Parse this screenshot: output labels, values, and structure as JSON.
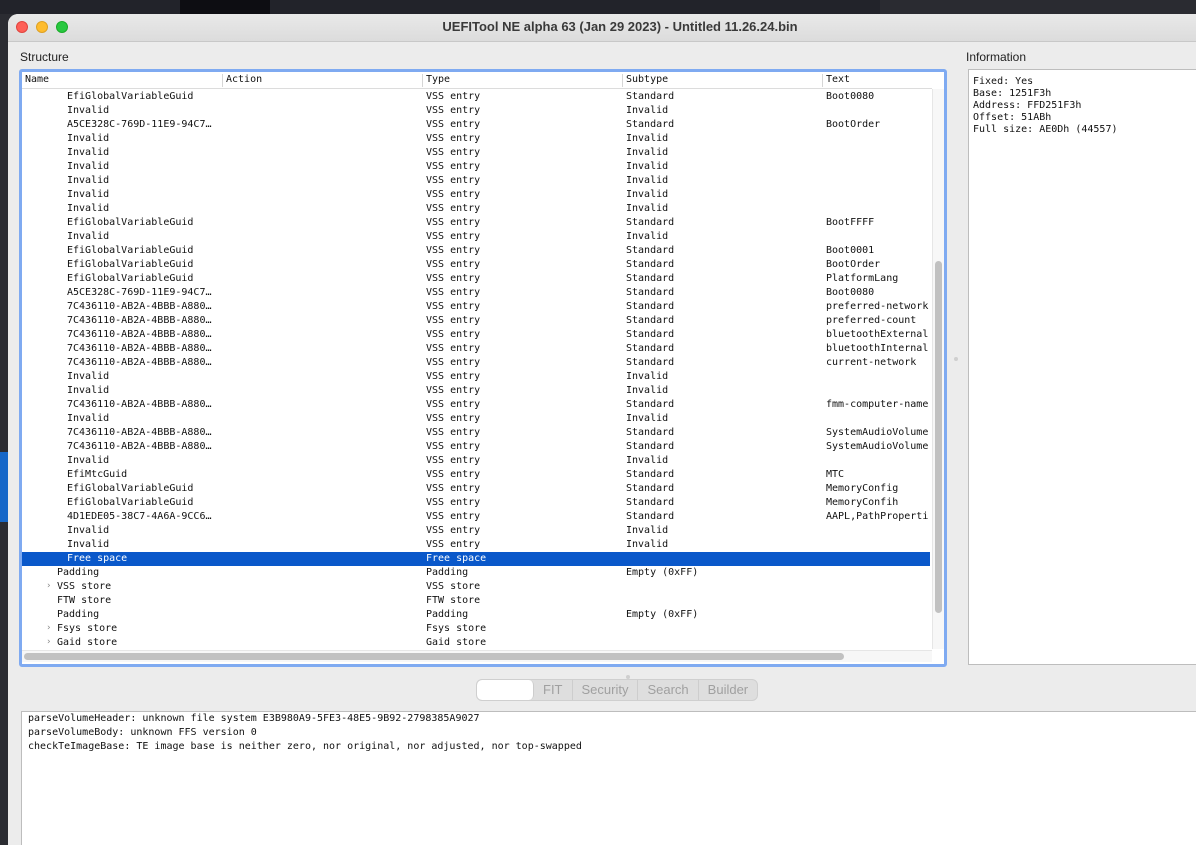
{
  "window": {
    "title": "UEFITool NE alpha 63 (Jan 29 2023) - Untitled 11.26.24.bin"
  },
  "structure": {
    "label": "Structure",
    "columns": [
      "Name",
      "Action",
      "Type",
      "Subtype",
      "Text"
    ],
    "rows": [
      {
        "name": "EfiGlobalVariableGuid",
        "type": "VSS entry",
        "subtype": "Standard",
        "text": "Boot0080",
        "indent": 3
      },
      {
        "name": "Invalid",
        "type": "VSS entry",
        "subtype": "Invalid",
        "text": "",
        "indent": 3
      },
      {
        "name": "A5CE328C-769D-11E9-94C7…",
        "type": "VSS entry",
        "subtype": "Standard",
        "text": "BootOrder",
        "indent": 3
      },
      {
        "name": "Invalid",
        "type": "VSS entry",
        "subtype": "Invalid",
        "text": "",
        "indent": 3
      },
      {
        "name": "Invalid",
        "type": "VSS entry",
        "subtype": "Invalid",
        "text": "",
        "indent": 3
      },
      {
        "name": "Invalid",
        "type": "VSS entry",
        "subtype": "Invalid",
        "text": "",
        "indent": 3
      },
      {
        "name": "Invalid",
        "type": "VSS entry",
        "subtype": "Invalid",
        "text": "",
        "indent": 3
      },
      {
        "name": "Invalid",
        "type": "VSS entry",
        "subtype": "Invalid",
        "text": "",
        "indent": 3
      },
      {
        "name": "Invalid",
        "type": "VSS entry",
        "subtype": "Invalid",
        "text": "",
        "indent": 3
      },
      {
        "name": "EfiGlobalVariableGuid",
        "type": "VSS entry",
        "subtype": "Standard",
        "text": "BootFFFF",
        "indent": 3
      },
      {
        "name": "Invalid",
        "type": "VSS entry",
        "subtype": "Invalid",
        "text": "",
        "indent": 3
      },
      {
        "name": "EfiGlobalVariableGuid",
        "type": "VSS entry",
        "subtype": "Standard",
        "text": "Boot0001",
        "indent": 3
      },
      {
        "name": "EfiGlobalVariableGuid",
        "type": "VSS entry",
        "subtype": "Standard",
        "text": "BootOrder",
        "indent": 3
      },
      {
        "name": "EfiGlobalVariableGuid",
        "type": "VSS entry",
        "subtype": "Standard",
        "text": "PlatformLang",
        "indent": 3
      },
      {
        "name": "A5CE328C-769D-11E9-94C7…",
        "type": "VSS entry",
        "subtype": "Standard",
        "text": "Boot0080",
        "indent": 3
      },
      {
        "name": "7C436110-AB2A-4BBB-A880…",
        "type": "VSS entry",
        "subtype": "Standard",
        "text": "preferred-network",
        "indent": 3
      },
      {
        "name": "7C436110-AB2A-4BBB-A880…",
        "type": "VSS entry",
        "subtype": "Standard",
        "text": "preferred-count",
        "indent": 3
      },
      {
        "name": "7C436110-AB2A-4BBB-A880…",
        "type": "VSS entry",
        "subtype": "Standard",
        "text": "bluetoothExternal",
        "indent": 3
      },
      {
        "name": "7C436110-AB2A-4BBB-A880…",
        "type": "VSS entry",
        "subtype": "Standard",
        "text": "bluetoothInternal",
        "indent": 3
      },
      {
        "name": "7C436110-AB2A-4BBB-A880…",
        "type": "VSS entry",
        "subtype": "Standard",
        "text": "current-network",
        "indent": 3
      },
      {
        "name": "Invalid",
        "type": "VSS entry",
        "subtype": "Invalid",
        "text": "",
        "indent": 3
      },
      {
        "name": "Invalid",
        "type": "VSS entry",
        "subtype": "Invalid",
        "text": "",
        "indent": 3
      },
      {
        "name": "7C436110-AB2A-4BBB-A880…",
        "type": "VSS entry",
        "subtype": "Standard",
        "text": "fmm-computer-name",
        "indent": 3
      },
      {
        "name": "Invalid",
        "type": "VSS entry",
        "subtype": "Invalid",
        "text": "",
        "indent": 3
      },
      {
        "name": "7C436110-AB2A-4BBB-A880…",
        "type": "VSS entry",
        "subtype": "Standard",
        "text": "SystemAudioVolume",
        "indent": 3
      },
      {
        "name": "7C436110-AB2A-4BBB-A880…",
        "type": "VSS entry",
        "subtype": "Standard",
        "text": "SystemAudioVolume",
        "indent": 3
      },
      {
        "name": "Invalid",
        "type": "VSS entry",
        "subtype": "Invalid",
        "text": "",
        "indent": 3
      },
      {
        "name": "EfiMtcGuid",
        "type": "VSS entry",
        "subtype": "Standard",
        "text": "MTC",
        "indent": 3
      },
      {
        "name": "EfiGlobalVariableGuid",
        "type": "VSS entry",
        "subtype": "Standard",
        "text": "MemoryConfig",
        "indent": 3
      },
      {
        "name": "EfiGlobalVariableGuid",
        "type": "VSS entry",
        "subtype": "Standard",
        "text": "MemoryConfih",
        "indent": 3
      },
      {
        "name": "4D1EDE05-38C7-4A6A-9CC6…",
        "type": "VSS entry",
        "subtype": "Standard",
        "text": "AAPL,PathProperti",
        "indent": 3
      },
      {
        "name": "Invalid",
        "type": "VSS entry",
        "subtype": "Invalid",
        "text": "",
        "indent": 3
      },
      {
        "name": "Invalid",
        "type": "VSS entry",
        "subtype": "Invalid",
        "text": "",
        "indent": 3
      },
      {
        "name": "Free space",
        "type": "Free space",
        "subtype": "",
        "text": "",
        "indent": 3,
        "selected": true
      },
      {
        "name": "Padding",
        "type": "Padding",
        "subtype": "Empty (0xFF)",
        "text": "",
        "indent": 2
      },
      {
        "name": "VSS store",
        "type": "VSS store",
        "subtype": "",
        "text": "",
        "indent": 2,
        "expandable": true
      },
      {
        "name": "FTW store",
        "type": "FTW store",
        "subtype": "",
        "text": "",
        "indent": 2
      },
      {
        "name": "Padding",
        "type": "Padding",
        "subtype": "Empty (0xFF)",
        "text": "",
        "indent": 2
      },
      {
        "name": "Fsys store",
        "type": "Fsys store",
        "subtype": "",
        "text": "",
        "indent": 2,
        "expandable": true
      },
      {
        "name": "Gaid store",
        "type": "Gaid store",
        "subtype": "",
        "text": "",
        "indent": 2,
        "expandable": true
      }
    ]
  },
  "information": {
    "label": "Information",
    "lines": [
      "Fixed: Yes",
      "Base: 1251F3h",
      "Address: FFD251F3h",
      "Offset: 51ABh",
      "Full size: AE0Dh (44557)"
    ]
  },
  "tabs": [
    {
      "label": "",
      "active": true
    },
    {
      "label": "FIT"
    },
    {
      "label": "Security"
    },
    {
      "label": "Search"
    },
    {
      "label": "Builder"
    }
  ],
  "messages": [
    "parseVolumeHeader: unknown file system E3B980A9-5FE3-48E5-9B92-2798385A9027",
    "parseVolumeBody: unknown FFS version 0",
    "checkTeImageBase: TE image base is neither zero, nor original, nor adjusted, nor top-swapped"
  ],
  "colors": {
    "selection": "#0a58ca",
    "focus_ring": "#7faaf1"
  }
}
